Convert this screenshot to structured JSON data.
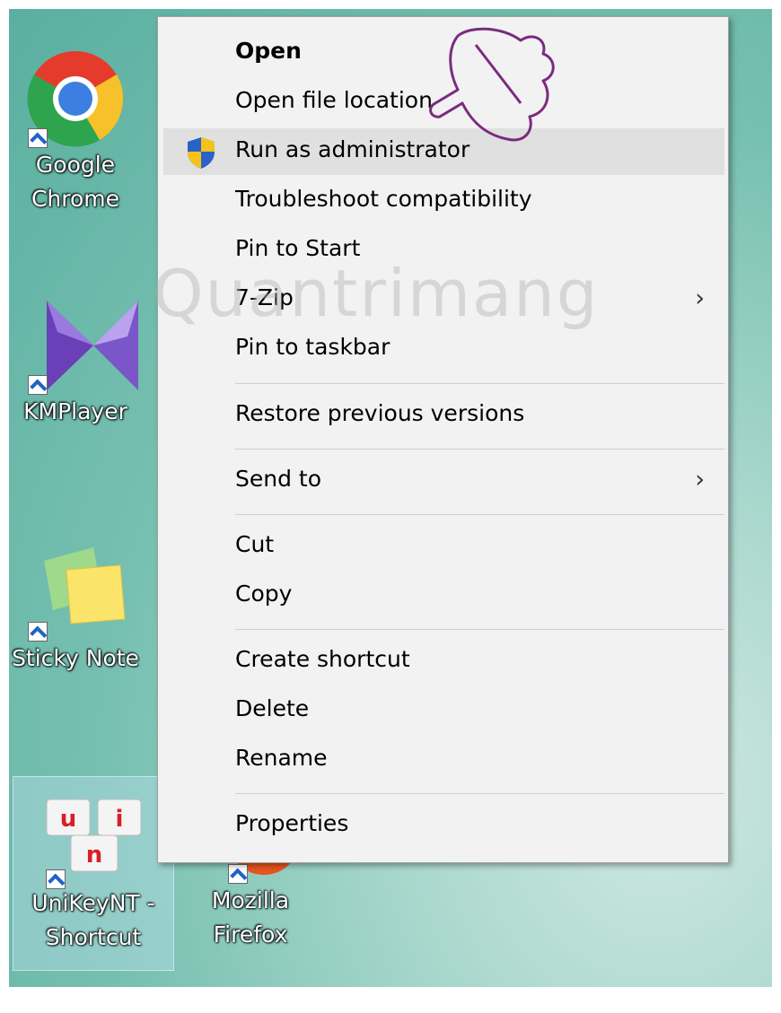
{
  "desktop": {
    "icons": [
      {
        "label": "Google Chrome",
        "line1": "Google",
        "line2": "Chrome",
        "icon": "chrome-icon"
      },
      {
        "label": "KMPlayer",
        "line1": "KMPlayer",
        "icon": "kmplayer-icon"
      },
      {
        "label": "Sticky Notes",
        "line1": "Sticky Note",
        "icon": "sticky-notes-icon"
      },
      {
        "label": "UniKeyNT - Shortcut",
        "line1": "UniKeyNT -",
        "line2": "Shortcut",
        "icon": "unikey-icon",
        "keys": [
          "u",
          "i",
          "n"
        ]
      },
      {
        "label": "Mozilla Firefox",
        "line1": "Mozilla",
        "line2": "Firefox",
        "icon": "firefox-icon"
      }
    ]
  },
  "context_menu": {
    "items": [
      {
        "label": "Open",
        "bold": true
      },
      {
        "label": "Open file location"
      },
      {
        "label": "Run as administrator",
        "icon": "uac-shield-icon",
        "highlighted": true
      },
      {
        "label": "Troubleshoot compatibility"
      },
      {
        "label": "Pin to Start"
      },
      {
        "label": "7-Zip",
        "submenu": true
      },
      {
        "label": "Pin to taskbar"
      },
      {
        "label": "Restore previous versions"
      },
      {
        "label": "Send to",
        "submenu": true
      },
      {
        "label": "Cut"
      },
      {
        "label": "Copy"
      },
      {
        "label": "Create shortcut"
      },
      {
        "label": "Delete"
      },
      {
        "label": "Rename"
      },
      {
        "label": "Properties"
      }
    ],
    "submenu_glyph": "›"
  },
  "watermark": "Quantrimang",
  "colors": {
    "menu_bg": "#f2f2f2",
    "highlight": "#e0e0e0",
    "desktop": "#77c0b1",
    "pointer_hand": "#7a2b7f"
  }
}
